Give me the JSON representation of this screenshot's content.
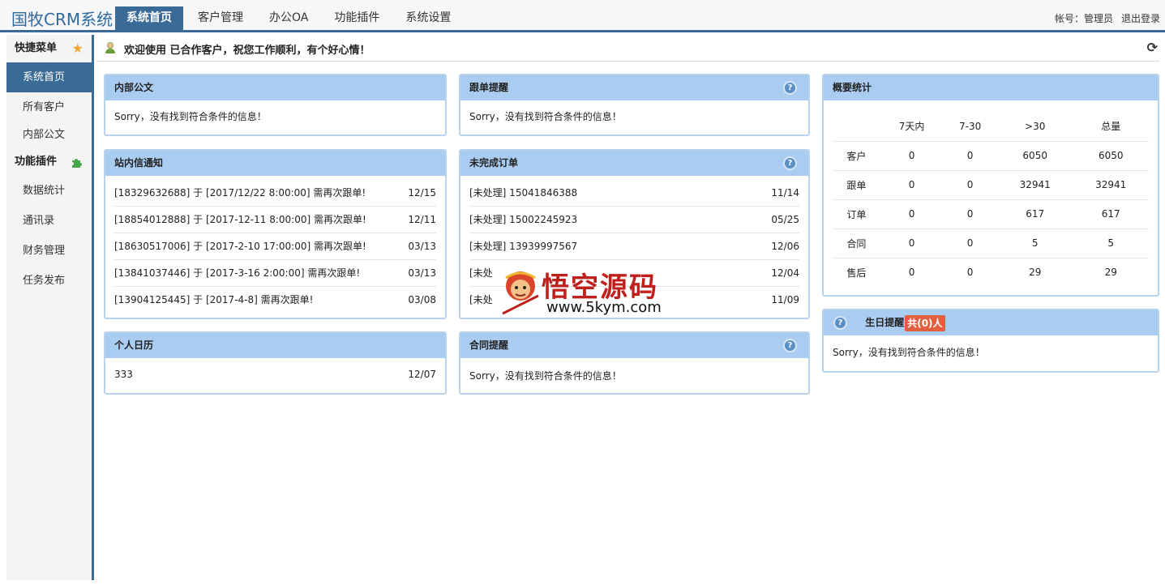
{
  "app": {
    "title": "国牧CRM系统",
    "account_label": "帐号：管理员",
    "logout_label": "退出登录"
  },
  "nav": {
    "items": [
      {
        "label": "系统首页",
        "active": true
      },
      {
        "label": "客户管理"
      },
      {
        "label": "办公OA"
      },
      {
        "label": "功能插件"
      },
      {
        "label": "系统设置"
      }
    ]
  },
  "sidebar": {
    "quick_menu": "快捷菜单",
    "items1": [
      "系统首页",
      "所有客户",
      "内部公文"
    ],
    "plugins": "功能插件",
    "items2": [
      "数据统计",
      "通讯录",
      "财务管理",
      "任务发布"
    ]
  },
  "welcome": {
    "text": "欢迎使用 已合作客户，祝您工作顺利，有个好心情！"
  },
  "empty_msg": "Sorry，没有找到符合条件的信息！",
  "panels": {
    "internal_doc": {
      "title": "内部公文"
    },
    "followup": {
      "title": "跟单提醒"
    },
    "messages": {
      "title": "站内信通知",
      "rows": [
        {
          "text": "[18329632688] 于 [2017/12/22 8:00:00] 需再次跟单!",
          "date": "12/15"
        },
        {
          "text": "[18854012888] 于 [2017-12-11 8:00:00] 需再次跟单!",
          "date": "12/11"
        },
        {
          "text": "[18630517006] 于 [2017-2-10 17:00:00] 需再次跟单!",
          "date": "03/13"
        },
        {
          "text": "[13841037446] 于 [2017-3-16 2:00:00] 需再次跟单!",
          "date": "03/13"
        },
        {
          "text": "[13904125445] 于 [2017-4-8] 需再次跟单!",
          "date": "03/08"
        }
      ]
    },
    "orders": {
      "title": "未完成订单",
      "rows": [
        {
          "text": "[未处理] 15041846388",
          "date": "11/14"
        },
        {
          "text": "[未处理] 15002245923",
          "date": "05/25"
        },
        {
          "text": "[未处理] 13939997567",
          "date": "12/06"
        },
        {
          "text": "[未处",
          "date": "12/04"
        },
        {
          "text": "[未处",
          "date": "11/09"
        }
      ]
    },
    "calendar": {
      "title": "个人日历",
      "rows": [
        {
          "text": "333",
          "date": "12/07"
        }
      ]
    },
    "contract": {
      "title": "合同提醒"
    },
    "stats": {
      "title": "概要统计",
      "headers": [
        "",
        "7天内",
        "7-30",
        ">30",
        "总量"
      ],
      "rows": [
        [
          "客户",
          "0",
          "0",
          "6050",
          "6050"
        ],
        [
          "跟单",
          "0",
          "0",
          "32941",
          "32941"
        ],
        [
          "订单",
          "0",
          "0",
          "617",
          "617"
        ],
        [
          "合同",
          "0",
          "0",
          "5",
          "5"
        ],
        [
          "售后",
          "0",
          "0",
          "29",
          "29"
        ]
      ]
    },
    "birthday": {
      "title": "生日提醒",
      "badge": "共(0)人"
    }
  },
  "watermark": {
    "text": "悟空源码",
    "url": "www.5kym.com"
  },
  "colors": {
    "primary": "#3a6a96",
    "panel_header": "#a9ccf0",
    "badge": "#e2603f"
  }
}
